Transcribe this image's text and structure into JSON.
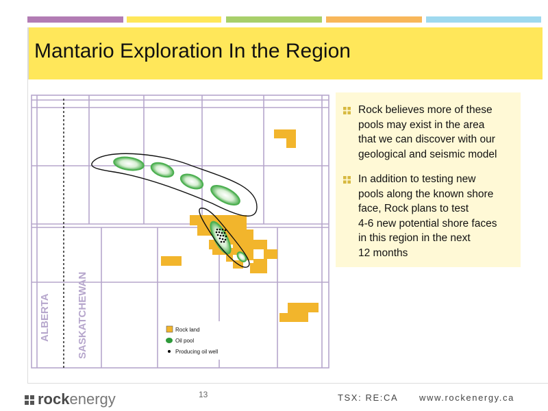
{
  "header_colors": [
    "#b27cb4",
    "#ffe75a",
    "#a8cf6a",
    "#f8b75a",
    "#9fd9ef"
  ],
  "title": "Mantario Exploration In the Region",
  "map": {
    "province_labels": [
      "ALBERTA",
      "SASKATCHEWAN"
    ],
    "legend": [
      {
        "label": "Rock land",
        "icon": "orange-square-icon",
        "color": "#f2b52c"
      },
      {
        "label": "Oil pool",
        "icon": "green-oval-icon",
        "color": "#2e9a3a"
      },
      {
        "label": "Producing oil well",
        "icon": "black-dot-icon",
        "color": "#000000"
      }
    ],
    "colors": {
      "grid": "#b6a6cc",
      "land": "#f2b52c",
      "pool": "#4caf50"
    }
  },
  "bullets": [
    {
      "text": "Rock believes more of these\npools may exist in the area\nthat we can discover with our\ngeological and seismic model"
    },
    {
      "text": "In addition to testing new\npools along the known shore\nface, Rock plans to test\n4-6 new potential shore faces\nin this region in the next\n12 months"
    }
  ],
  "footer": {
    "logo_rock": "rock",
    "logo_energy": "energy",
    "page_number": "13",
    "ticker": "TSX: RE:CA",
    "website": "www.rockenergy.ca"
  }
}
